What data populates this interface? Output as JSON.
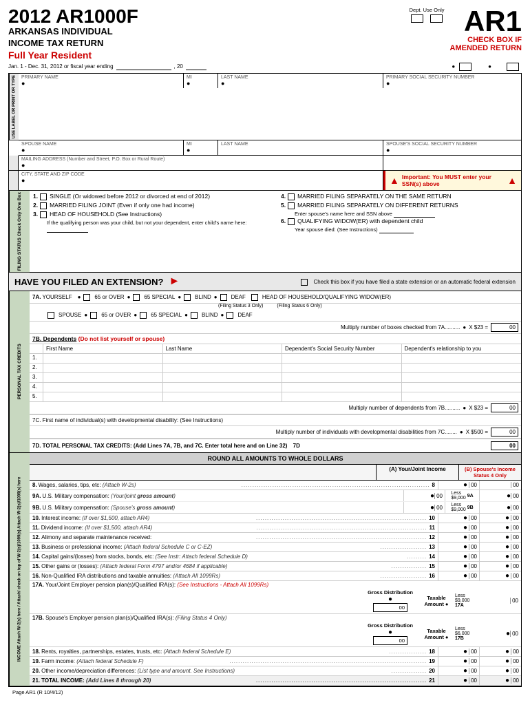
{
  "header": {
    "form_number": "2012 AR1000F",
    "form_subtitle1": "ARKANSAS INDIVIDUAL",
    "form_subtitle2": "INCOME TAX RETURN",
    "full_year": "Full Year Resident",
    "ar1": "AR1",
    "check_box_if": "CHECK BOX IF",
    "amended_return": "AMENDED RETURN",
    "dept_use_only": "Dept. Use Only",
    "fiscal_year_text": "Jan. 1 - Dec. 31, 2012 or fiscal year ending",
    "fiscal_year_suffix": ", 20"
  },
  "fields": {
    "primary_name_label": "PRIMARY NAME",
    "mi_label": "MI",
    "last_name_label": "LAST NAME",
    "ssn_label": "PRIMARY SOCIAL SECURITY NUMBER",
    "spouse_name_label": "SPOUSE NAME",
    "spouse_ssn_label": "SPOUSE'S SOCIAL SECURITY NUMBER",
    "address_label": "MAILING ADDRESS (Number and Street, P.O. Box or Rural Route)",
    "city_label": "CITY, STATE AND ZIP CODE",
    "important_text": "Important: You MUST enter your SSN(s) above",
    "side_label_1": "USE LABEL OR PRINT OR TYPE"
  },
  "filing_status": {
    "side_label": "FILING STATUS Check Only One Box",
    "items": [
      {
        "num": "1.",
        "text": "SINGLE (Or widowed before 2012 or divorced at end of 2012)"
      },
      {
        "num": "2.",
        "text": "MARRIED FILING JOINT (Even if only one had income)"
      },
      {
        "num": "3.",
        "text": "HEAD OF HOUSEHOLD (See Instructions)"
      }
    ],
    "item3_sub": "If the qualifying person was your child, but not your dependent, enter child's name here:",
    "col2_items": [
      {
        "num": "4.",
        "text": "MARRIED FILING SEPARATELY ON THE SAME RETURN"
      },
      {
        "num": "5.",
        "text": "MARRIED FILING SEPARATELY ON DIFFERENT RETURNS"
      },
      {
        "num": "6.",
        "text": "QUALIFYING WIDOW(ER) with dependent child"
      }
    ],
    "spouse_ssn_line": "Enter spouse's name here and SSN above",
    "widow_line": "Year spouse died: (See Instructions)",
    "state_extension": "Check this box if you have filed a state extension or an automatic federal extension"
  },
  "extension": {
    "banner_text": "HAVE YOU FILED AN EXTENSION?",
    "check_text": "Check this box if you have filed a state extension or an automatic federal extension"
  },
  "credits_7a": {
    "label": "7A.",
    "yourself": "YOURSELF",
    "over65": "65 or OVER",
    "special65": "65 SPECIAL",
    "blind": "BLIND",
    "deaf": "DEAF",
    "head_household": "HEAD OF HOUSEHOLD/QUALIFYING WIDOW(ER)",
    "filing_status3": "(Filing Status 3 Only)",
    "filing_status6": "(Filing Status 6 Only)",
    "spouse": "SPOUSE",
    "multiply_text": "Multiply number of boxes checked from 7A..........",
    "x23": "X $23 =",
    "00": "00"
  },
  "dependents": {
    "label": "7B. Dependents",
    "label_note": "(Do not list yourself or spouse)",
    "col_first": "First Name",
    "col_last": "Last Name",
    "col_ssn": "Dependent's Social Security Number",
    "col_relationship": "Dependent's relationship to you",
    "rows": [
      "1.",
      "2.",
      "3.",
      "4.",
      "5."
    ],
    "multiply_text": "Multiply number of dependents from 7B..........",
    "x23": "X $23 =",
    "00": "00",
    "developmental_7c": "7C. First name of individual(s) with developmental disability: (See Instructions)",
    "dev_multiply": "Multiply number of individuals with developmental disabilities from 7C........",
    "x500": "X $500 =",
    "total_7d": "7D. TOTAL PERSONAL TAX CREDITS:",
    "total_7d_note": "(Add Lines 7A, 7B, and 7C. Enter total here and on Line 32)",
    "total_7d_suffix": "7D",
    "total_7d_00": "00"
  },
  "income": {
    "round_header": "ROUND ALL AMOUNTS TO WHOLE DOLLARS",
    "col_a": "(A) Your/Joint Income",
    "col_b": "(B) Spouse's Income Status 4 Only",
    "side_label": "INCOME Attach W-2(s) here / Attach/ check on top of W-2(s)/1099(s) Attach W-2(s)/1099(s) here",
    "lines": [
      {
        "num": "8",
        "text": "Wages, salaries, tips, etc: (Attach W-2s)",
        "dots": ".......................................................................................",
        "linenum": "8"
      },
      {
        "num": "9A",
        "text": "U.S. Military compensation: (Your/joint gross amount)",
        "note": ""
      },
      {
        "num": "9B",
        "text": "U.S. Military compensation: (Spouse's gross amount)",
        "note": ""
      },
      {
        "num": "10",
        "text": "Interest income: (If over $1,500, attach AR4)",
        "dots": "...............................................................................",
        "linenum": "10"
      },
      {
        "num": "11",
        "text": "Dividend income: (If over $1,500, attach AR4)",
        "dots": "...............................................................................",
        "linenum": "11"
      },
      {
        "num": "12",
        "text": "Alimony and separate maintenance received:",
        "dots": "...........................................................................",
        "linenum": "12"
      },
      {
        "num": "13",
        "text": "Business or professional income: (Attach federal Schedule C or C-EZ)",
        "dots": ".........................................",
        "linenum": "13"
      },
      {
        "num": "14",
        "text": "Capital gains/(losses) from stocks, bonds, etc: (See Instr: Attach federal Schedule D)",
        "dots": ".............",
        "linenum": "14"
      },
      {
        "num": "15",
        "text": "Other gains or (losses): (Attach federal Form 4797 and/or 4684 if applicable)",
        "dots": ".....................",
        "linenum": "15"
      },
      {
        "num": "16",
        "text": "Non-Qualified IRA distributions and taxable annuities: (Attach All 1099Rs)",
        "dots": "........................",
        "linenum": "16"
      },
      {
        "num": "17A",
        "text": "17A.Your/Joint Employer pension plan(s)/Qualified IRA(s):",
        "note": "(See Instructions - Attach All 1099Rs)",
        "gross": "Gross Distribution",
        "taxable": "Taxable Amount",
        "less": "Less $9,000"
      },
      {
        "num": "17B",
        "text": "17B.Spouse's Employer pension plan(s)/Qualified IRA(s):",
        "note": "(Filing Status 4 Only)",
        "gross": "Gross Distribution",
        "taxable": "Taxable Amount",
        "less": "Less $6,000"
      },
      {
        "num": "18",
        "text": "Rents, royalties, partnerships, estates, trusts, etc: (Attach federal Schedule E)",
        "dots": "..........................",
        "linenum": "18"
      },
      {
        "num": "19",
        "text": "Farm income: (Attach federal Schedule F)",
        "dots": "...........................................................................................",
        "linenum": "19"
      },
      {
        "num": "20",
        "text": "Other income/depreciation differences: (List type and amount. See Instructions)",
        "dots": "................",
        "linenum": "20"
      },
      {
        "num": "21",
        "text": "TOTAL INCOME: (Add Lines 8 through 20)",
        "dots": "...............................................................................",
        "linenum": "21"
      }
    ]
  },
  "footer": {
    "page": "Page AR1 (R 10/4/12)"
  }
}
